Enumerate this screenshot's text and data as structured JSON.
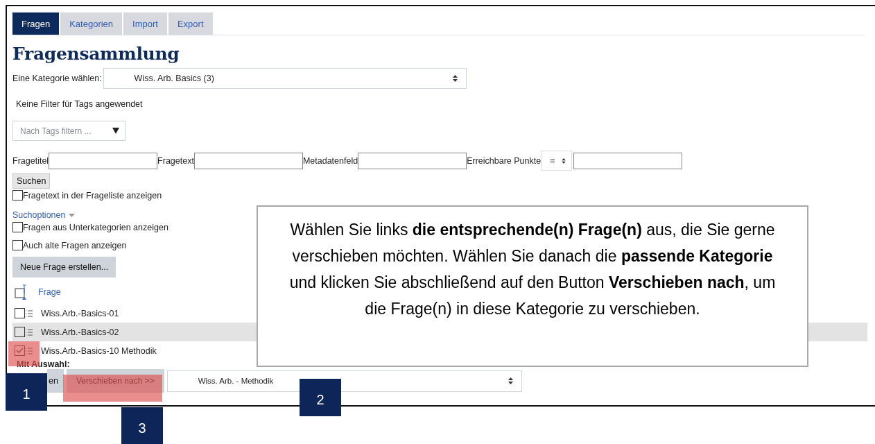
{
  "tabs": [
    {
      "label": "Fragen",
      "selected": true
    },
    {
      "label": "Kategorien",
      "selected": false
    },
    {
      "label": "Import",
      "selected": false
    },
    {
      "label": "Export",
      "selected": false
    }
  ],
  "title": "Fragensammlung",
  "category_select": {
    "label": "Eine Kategorie wählen:",
    "value": "Wiss. Arb. Basics (3)"
  },
  "tag_filter": {
    "status": "Keine Filter für Tags angewendet",
    "placeholder": "Nach Tags filtern ..."
  },
  "search_fields": [
    {
      "label": "Fragetitel"
    },
    {
      "label": "Fragetext"
    },
    {
      "label": "Metadatenfeld"
    },
    {
      "label": "Erreichbare Punkte",
      "operator": "="
    }
  ],
  "search_button": "Suchen",
  "show_text_option": {
    "label": "Fragetext in der Frageliste anzeigen",
    "checked": false
  },
  "search_options_link": "Suchoptionen",
  "options": [
    {
      "label": "Fragen aus Unterkategorien anzeigen",
      "checked": false
    },
    {
      "label": "Auch alte Fragen anzeigen",
      "checked": false
    }
  ],
  "new_question_button": "Neue Frage erstellen...",
  "table": {
    "column": "Frage",
    "rows": [
      {
        "title": "Wiss.Arb.-Basics-01",
        "checked": false,
        "highlighted": false
      },
      {
        "title": "Wiss.Arb.-Basics-02",
        "checked": false,
        "highlighted": true
      },
      {
        "title": "Wiss.Arb.-Basics-10 Methodik",
        "checked": true,
        "highlighted": false
      }
    ]
  },
  "with_selection": {
    "label": "Mit Auswahl:",
    "delete_button": "en",
    "move_button": "Verschieben nach >>",
    "target": "Wiss. Arb. - Methodik"
  },
  "callout": "Wählen Sie links **die entsprechende(n) Frage(n)** aus, die Sie gerne verschieben möchten. Wählen Sie danach die **passende Kategorie** und klicken Sie abschließend auf den Button **Verschieben nach**, um die Frage(n) in diese Kategorie zu verschieben.",
  "markers": [
    "1",
    "2",
    "3"
  ]
}
